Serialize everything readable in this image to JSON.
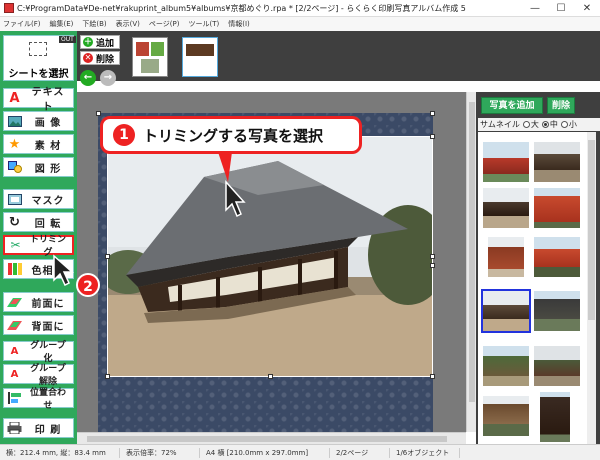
{
  "window": {
    "title": "C:¥ProgramData¥De-net¥rakuprint_album5¥albums¥京都めぐり.rpa * [2/2ページ] - らくらく印刷写真アルバム作成 5",
    "minimize_glyph": "—",
    "maximize_glyph": "☐",
    "close_glyph": "✕"
  },
  "menu": [
    "ファイル(F)",
    "編集(E)",
    "下絵(B)",
    "表示(V)",
    "ページ(P)",
    "ツール(T)",
    "情報(I)"
  ],
  "tools": {
    "select": "シートを選択",
    "out_badge": "OUT",
    "text": "テキスト",
    "image": "画 像",
    "material": "素 材",
    "shape": "図 形",
    "mask": "マスク",
    "rotate": "回 転",
    "trimming": "トリミング",
    "color": "色相調",
    "front": "前面に",
    "back": "背面に",
    "group": "グループ化",
    "ungroup": "グループ解除",
    "align": "位置合わせ",
    "print": "印 刷"
  },
  "actions": {
    "add": "追加",
    "delete": "削除",
    "add_icon": "＋",
    "delete_icon": "✕",
    "back_arrow": "←",
    "forward_arrow": "→"
  },
  "callouts": {
    "step1_num": "1",
    "step1_text": "トリミングする写真を選択",
    "step2_num": "2"
  },
  "right_panel": {
    "add_photo": "写真を追加",
    "delete": "削除",
    "thumbnail_label": "サムネイル",
    "size_large": "大",
    "size_medium": "中",
    "size_small": "小",
    "selected_size": "中"
  },
  "status": {
    "size": "横：212.4 mm, 縦：83.4 mm",
    "zoom": "表示倍率：72%",
    "paper": "A4 横 [210.0mm x 297.0mm]",
    "page": "2/2ページ",
    "objects": "1/6オブジェクト"
  },
  "colors": {
    "panel_green": "#2fa85b",
    "accent_red": "#e22222",
    "dark_strip": "#3f3f3f"
  }
}
